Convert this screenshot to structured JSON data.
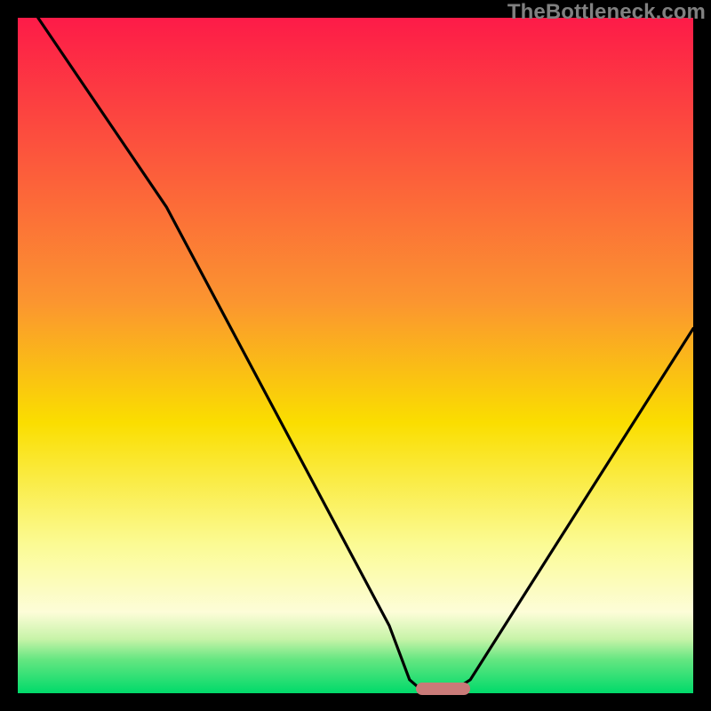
{
  "watermark": "TheBottleneck.com",
  "chart_data": {
    "type": "line",
    "title": "",
    "xlabel": "",
    "ylabel": "",
    "xlim": [
      0,
      100
    ],
    "ylim": [
      0,
      100
    ],
    "optimal_x": 62,
    "marker": {
      "x_start": 59,
      "x_end": 67,
      "color": "#c97a78"
    },
    "gradient_stops": [
      {
        "offset": 0,
        "color": "#fd1b48"
      },
      {
        "offset": 42,
        "color": "#fb9530"
      },
      {
        "offset": 60,
        "color": "#fade00"
      },
      {
        "offset": 78,
        "color": "#fbfb94"
      },
      {
        "offset": 88,
        "color": "#fdfdd8"
      },
      {
        "offset": 92,
        "color": "#c7f3a8"
      },
      {
        "offset": 95,
        "color": "#65e681"
      },
      {
        "offset": 100,
        "color": "#00da6a"
      }
    ],
    "series": [
      {
        "name": "bottleneck-curve",
        "points": [
          {
            "x": 3,
            "y": 100
          },
          {
            "x": 22,
            "y": 72
          },
          {
            "x": 55,
            "y": 10
          },
          {
            "x": 58,
            "y": 2
          },
          {
            "x": 59.5,
            "y": 0.7
          },
          {
            "x": 65,
            "y": 0.7
          },
          {
            "x": 67,
            "y": 2
          },
          {
            "x": 100,
            "y": 54
          }
        ]
      }
    ]
  }
}
